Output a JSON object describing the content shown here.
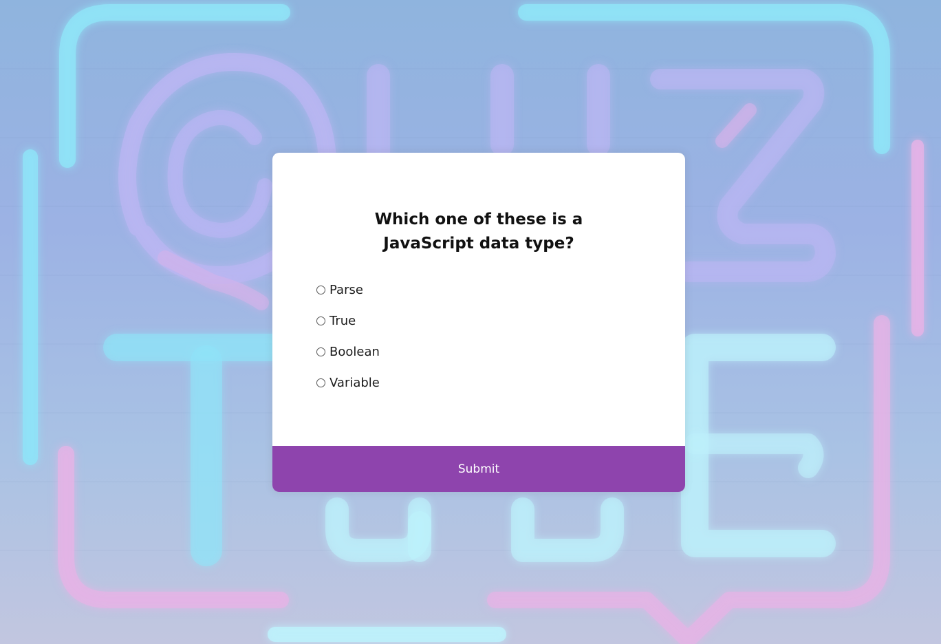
{
  "background": {
    "art_name": "neon-quiz-time-sign",
    "colors": {
      "cyan": "#8fe3f7",
      "lavender": "#b9b5f2",
      "pink": "#e6b3e6"
    }
  },
  "quiz": {
    "question": "Which one of these is a JavaScript data type?",
    "answers": [
      {
        "id": "a",
        "label": "Parse"
      },
      {
        "id": "b",
        "label": "True"
      },
      {
        "id": "c",
        "label": "Boolean"
      },
      {
        "id": "d",
        "label": "Variable"
      }
    ],
    "submit_label": "Submit",
    "accent_color": "#8e44ad"
  }
}
